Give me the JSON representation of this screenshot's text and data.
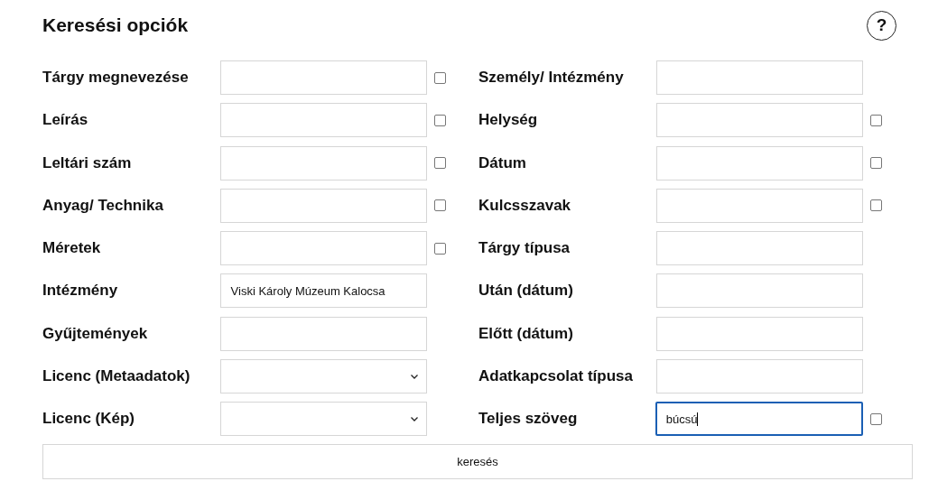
{
  "title": "Keresési opciók",
  "help_button": {
    "label": "?"
  },
  "columns": [
    [
      {
        "label": "Tárgy megnevezése",
        "kind": "text",
        "checkbox": {
          "checked": false
        }
      },
      {
        "label": "Leírás",
        "kind": "text",
        "checkbox": {
          "checked": false
        }
      },
      {
        "label": "Leltári szám",
        "kind": "text",
        "checkbox": {
          "checked": false
        }
      },
      {
        "label": "Anyag/ Technika",
        "kind": "text",
        "checkbox": {
          "checked": false
        }
      },
      {
        "label": "Méretek",
        "kind": "text",
        "checkbox": {
          "checked": false
        }
      },
      {
        "label": "Intézmény",
        "kind": "text",
        "value": "Viski Károly Múzeum Kalocsa"
      },
      {
        "label": "Gyűjtemények",
        "kind": "text"
      },
      {
        "label": "Licenc (Metaadatok)",
        "kind": "select"
      },
      {
        "label": "Licenc (Kép)",
        "kind": "select"
      }
    ],
    [
      {
        "label": "Személy/ Intézmény",
        "kind": "text"
      },
      {
        "label": "Helység",
        "kind": "text",
        "checkbox": {
          "checked": false
        }
      },
      {
        "label": "Dátum",
        "kind": "text",
        "checkbox": {
          "checked": false
        }
      },
      {
        "label": "Kulcsszavak",
        "kind": "text",
        "checkbox": {
          "checked": false
        }
      },
      {
        "label": "Tárgy típusa",
        "kind": "text"
      },
      {
        "label": "Után (dátum)",
        "kind": "text"
      },
      {
        "label": "Előtt (dátum)",
        "kind": "text"
      },
      {
        "label": "Adatkapcsolat típusa",
        "kind": "text"
      },
      {
        "label": "Teljes szöveg",
        "kind": "text",
        "focused": true,
        "value": "búcsú",
        "checkbox": {
          "checked": false
        }
      }
    ]
  ],
  "search_button": {
    "label": "keresés"
  }
}
